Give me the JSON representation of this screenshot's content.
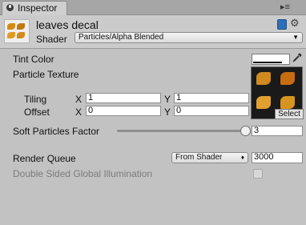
{
  "tab": {
    "label": "Inspector",
    "menu_glyph": "▸≡"
  },
  "material": {
    "name": "leaves decal"
  },
  "shader": {
    "label": "Shader",
    "value": "Particles/Alpha Blended"
  },
  "properties": {
    "tint_color": {
      "label": "Tint Color",
      "value": "#ffffff"
    },
    "particle_texture": {
      "label": "Particle Texture",
      "select_label": "Select",
      "tiling": {
        "label": "Tiling",
        "x_label": "X",
        "x": "1",
        "y_label": "Y",
        "y": "1"
      },
      "offset": {
        "label": "Offset",
        "x_label": "X",
        "x": "0",
        "y_label": "Y",
        "y": "0"
      }
    },
    "soft_particles": {
      "label": "Soft Particles Factor",
      "value": "3",
      "slider_fraction": 0.95
    },
    "render_queue": {
      "label": "Render Queue",
      "mode": "From Shader",
      "value": "3000"
    },
    "double_sided_gi": {
      "label": "Double Sided Global Illumination",
      "checked": false
    }
  },
  "icons": {
    "tab": "inspector-icon",
    "help": "book-icon",
    "settings": "gear-icon",
    "eyedropper": "eyedropper-icon"
  },
  "colors": {
    "background": "#c2c2c2",
    "leaf": "#d48a16"
  }
}
